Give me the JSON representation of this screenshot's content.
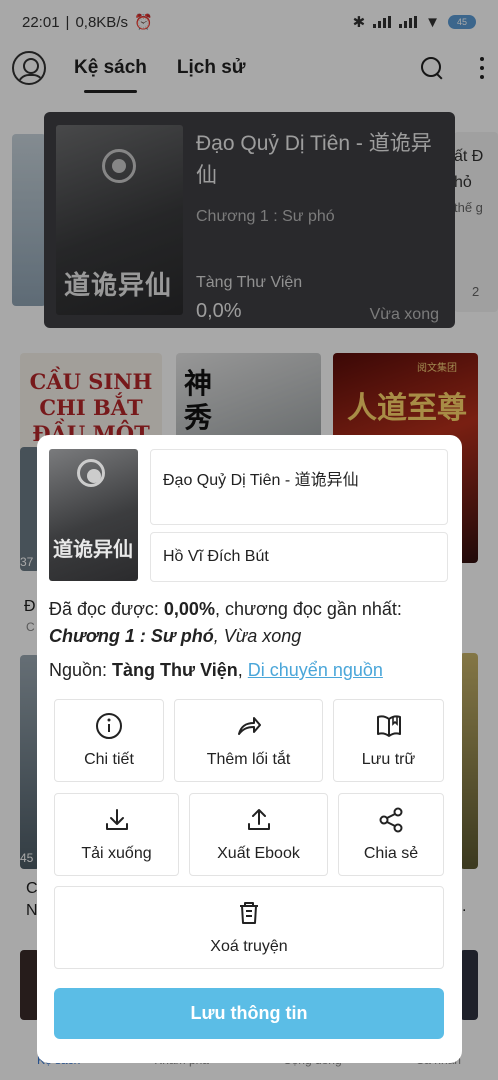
{
  "status_bar": {
    "time": "22:01",
    "speed": "0,8KB/s",
    "battery": "45"
  },
  "header": {
    "tabs": [
      {
        "label": "Kệ sách",
        "active": true
      },
      {
        "label": "Lịch sử",
        "active": false
      }
    ]
  },
  "featured": {
    "title": "Đạo Quỷ Dị Tiên - 道诡异仙",
    "chapter": "Chương 1 : Sư phó",
    "source": "Tàng Thư Viện",
    "progress": "0,0%",
    "updated": "Vừa xong",
    "cover_text": "道诡异仙"
  },
  "side_card_right": {
    "line1": "ất Đ",
    "line2": "hỏ",
    "line3": "thế g",
    "count": "2"
  },
  "grid": {
    "book1_cover_text": "CẦU SINH CHI BẮT ĐẦU MỘT",
    "book2_cover_text": "神秀",
    "book3_cover_text": "人道至尊",
    "book3_badge": "阅文集团",
    "left_counts": [
      "37",
      "45"
    ],
    "left_letters": [
      "Đ",
      "C",
      "C",
      "N"
    ],
    "right_letters": [
      "."
    ]
  },
  "bottom_nav": {
    "items": [
      "Kệ sách",
      "Khám phá",
      "Cộng đồng",
      "Cá nhân"
    ]
  },
  "sheet": {
    "book_name": "Đạo Quỷ Dị Tiên - 道诡异仙",
    "author": "Hồ Vĩ Đích Bút",
    "read_prefix": "Đã đọc được: ",
    "read_percent": "0,00%",
    "read_suffix": ", chương đọc gần nhất:",
    "last_chapter": "Chương 1 : Sư phó",
    "last_time": ", Vừa xong",
    "source_prefix": "Nguồn: ",
    "source_name": "Tàng Thư Viện",
    "source_sep": ", ",
    "move_source": "Di chuyển nguồn",
    "actions": {
      "details": "Chi tiết",
      "shortcut": "Thêm lối tắt",
      "archive": "Lưu trữ",
      "download": "Tải xuống",
      "export": "Xuất Ebook",
      "share": "Chia sẻ",
      "delete": "Xoá truyện"
    },
    "save_button": "Lưu thông tin"
  },
  "icons": [
    "avatar-icon",
    "search-icon",
    "more-icon",
    "info-icon",
    "share-arrow-icon",
    "book-open-icon",
    "download-icon",
    "upload-icon",
    "share-nodes-icon",
    "trash-icon"
  ],
  "colors": {
    "accent": "#5bbde6",
    "link": "#4aa6d9",
    "active_nav": "#3a7bd5"
  }
}
